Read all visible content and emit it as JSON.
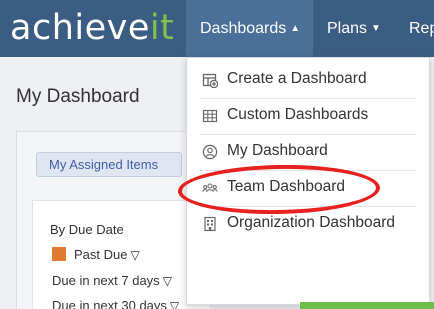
{
  "brand": {
    "logo_main": "achieve",
    "logo_accent": "it"
  },
  "nav": {
    "dashboards": "Dashboards",
    "plans": "Plans",
    "reports_partial": "Rep"
  },
  "page": {
    "title": "My Dashboard"
  },
  "tabs": {
    "active": "My Assigned Items"
  },
  "filters": {
    "group_title": "By Due Date",
    "rows": [
      "Past Due",
      "Due in next 7 days",
      "Due in next 30 days"
    ]
  },
  "dropdown": {
    "items": [
      {
        "label": "Create a Dashboard",
        "icon": "create-dashboard-icon"
      },
      {
        "label": "Custom Dashboards",
        "icon": "grid-icon"
      },
      {
        "label": "My Dashboard",
        "icon": "user-icon"
      },
      {
        "label": "Team Dashboard",
        "icon": "team-icon"
      },
      {
        "label": "Organization Dashboard",
        "icon": "building-icon"
      }
    ]
  },
  "colors": {
    "nav_bg": "#3c5d83",
    "nav_active": "#4a6f99",
    "brand_accent": "#7ec24a",
    "past_due": "#e07a2e",
    "highlight_ring": "#e8201e"
  }
}
